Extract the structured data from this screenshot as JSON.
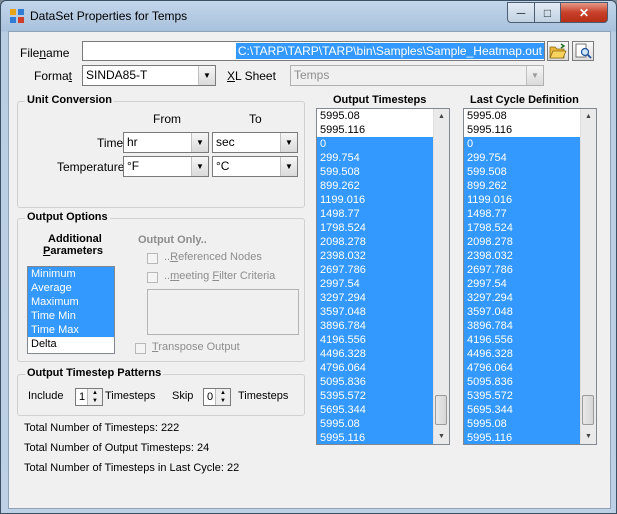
{
  "window": {
    "title": "DataSet Properties for Temps",
    "minimize_glyph": "─",
    "maximize_glyph": "□",
    "close_glyph": "✕"
  },
  "file": {
    "filename_label_pre": "File",
    "filename_label_u": "n",
    "filename_label_post": "ame",
    "filename_value": "C:\\TARP\\TARP\\TARP\\bin\\Samples\\Sample_Heatmap.out",
    "format_label_pre": "Forma",
    "format_label_u": "t",
    "format_value": "SINDA85-T",
    "xlsheet_label_u": "X",
    "xlsheet_label_post": "L Sheet",
    "xlsheet_value": "Temps"
  },
  "unit_conversion": {
    "title": "Unit Conversion",
    "from_header": "From",
    "to_header": "To",
    "time_label": "Time",
    "time_from": "hr",
    "time_to": "sec",
    "temperature_label": "Temperature",
    "temperature_from": "°F",
    "temperature_to": "°C"
  },
  "output_options": {
    "title": "Output Options",
    "additional_label": "Additional",
    "parameters_label_u": "P",
    "parameters_label_post": "arameters",
    "parameters": [
      {
        "label": "Minimum",
        "selected": true
      },
      {
        "label": "Average",
        "selected": true
      },
      {
        "label": "Maximum",
        "selected": true
      },
      {
        "label": "Time Min",
        "selected": true
      },
      {
        "label": "Time Max",
        "selected": true
      },
      {
        "label": "Delta",
        "selected": false
      }
    ],
    "output_only_label": "Output Only..",
    "referenced_nodes_pre": "..",
    "referenced_nodes_u": "R",
    "referenced_nodes_post": "eferenced Nodes",
    "filter_pre": "..",
    "filter_u": "m",
    "filter_mid": "eeting ",
    "filter_u2": "F",
    "filter_post": "ilter Criteria",
    "transpose_u": "T",
    "transpose_post": "ranspose Output"
  },
  "timestep_patterns": {
    "title": "Output Timestep Patterns",
    "include_label": "Include",
    "include_value": "1",
    "timesteps_label": "Timesteps",
    "skip_label": "Skip",
    "skip_value": "0"
  },
  "totals": {
    "total_timesteps": "Total Number of Timesteps: 222",
    "total_output_timesteps": "Total Number of Output Timesteps: 24",
    "total_last_cycle": "Total Number of Timesteps in Last Cycle: 22"
  },
  "output_timesteps": {
    "title": "Output Timesteps",
    "items": [
      {
        "v": "5995.08",
        "s": false
      },
      {
        "v": "5995.116",
        "s": false
      },
      {
        "v": "0",
        "s": true
      },
      {
        "v": "299.754",
        "s": true
      },
      {
        "v": "599.508",
        "s": true
      },
      {
        "v": "899.262",
        "s": true
      },
      {
        "v": "1199.016",
        "s": true
      },
      {
        "v": "1498.77",
        "s": true
      },
      {
        "v": "1798.524",
        "s": true
      },
      {
        "v": "2098.278",
        "s": true
      },
      {
        "v": "2398.032",
        "s": true
      },
      {
        "v": "2697.786",
        "s": true
      },
      {
        "v": "2997.54",
        "s": true
      },
      {
        "v": "3297.294",
        "s": true
      },
      {
        "v": "3597.048",
        "s": true
      },
      {
        "v": "3896.784",
        "s": true
      },
      {
        "v": "4196.556",
        "s": true
      },
      {
        "v": "4496.328",
        "s": true
      },
      {
        "v": "4796.064",
        "s": true
      },
      {
        "v": "5095.836",
        "s": true
      },
      {
        "v": "5395.572",
        "s": true
      },
      {
        "v": "5695.344",
        "s": true
      },
      {
        "v": "5995.08",
        "s": true
      },
      {
        "v": "5995.116",
        "s": true
      }
    ]
  },
  "last_cycle": {
    "title": "Last Cycle Definition",
    "items": [
      {
        "v": "5995.08",
        "s": false
      },
      {
        "v": "5995.116",
        "s": false
      },
      {
        "v": "0",
        "s": true
      },
      {
        "v": "299.754",
        "s": true
      },
      {
        "v": "599.508",
        "s": true
      },
      {
        "v": "899.262",
        "s": true
      },
      {
        "v": "1199.016",
        "s": true
      },
      {
        "v": "1498.77",
        "s": true
      },
      {
        "v": "1798.524",
        "s": true
      },
      {
        "v": "2098.278",
        "s": true
      },
      {
        "v": "2398.032",
        "s": true
      },
      {
        "v": "2697.786",
        "s": true
      },
      {
        "v": "2997.54",
        "s": true
      },
      {
        "v": "3297.294",
        "s": true
      },
      {
        "v": "3597.048",
        "s": true
      },
      {
        "v": "3896.784",
        "s": true
      },
      {
        "v": "4196.556",
        "s": true
      },
      {
        "v": "4496.328",
        "s": true
      },
      {
        "v": "4796.064",
        "s": true
      },
      {
        "v": "5095.836",
        "s": true
      },
      {
        "v": "5395.572",
        "s": true
      },
      {
        "v": "5695.344",
        "s": true
      },
      {
        "v": "5995.08",
        "s": true
      },
      {
        "v": "5995.116",
        "s": true
      }
    ]
  },
  "icons": {
    "open_folder": "folder-open-icon",
    "preview": "preview-icon"
  },
  "colors": {
    "selection": "#3399ff",
    "titlebar": "#b9cde3",
    "close": "#c7402a"
  }
}
